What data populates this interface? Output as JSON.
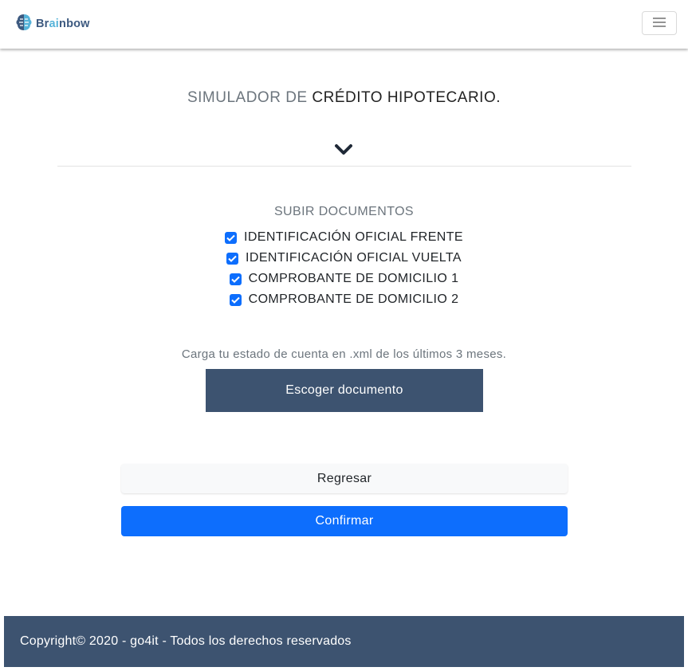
{
  "navbar": {
    "brand": {
      "prefix": "Br",
      "highlight": "ai",
      "suffix": "nbow"
    }
  },
  "header": {
    "title_light": "SIMULADOR DE",
    "title_dark": "CRÉDITO HIPOTECARIO."
  },
  "documents": {
    "title": "SUBIR DOCUMENTOS",
    "items": [
      {
        "label": "IDENTIFICACIÓN OFICIAL FRENTE",
        "checked": true
      },
      {
        "label": "IDENTIFICACIÓN OFICIAL VUELTA",
        "checked": true
      },
      {
        "label": "COMPROBANTE DE DOMICILIO 1",
        "checked": true
      },
      {
        "label": "COMPROBANTE DE DOMICILIO 2",
        "checked": true
      }
    ]
  },
  "upload": {
    "instruction": "Carga tu estado de cuenta en .xml de los últimos 3 meses.",
    "button_label": "Escoger documento"
  },
  "actions": {
    "back_label": "Regresar",
    "confirm_label": "Confirmar"
  },
  "footer": {
    "text": "Copyright© 2020 - go4it - Todos los derechos reservados"
  },
  "colors": {
    "primary": "#0d6efd",
    "navy": "#3d5370",
    "muted": "#6c757d"
  }
}
